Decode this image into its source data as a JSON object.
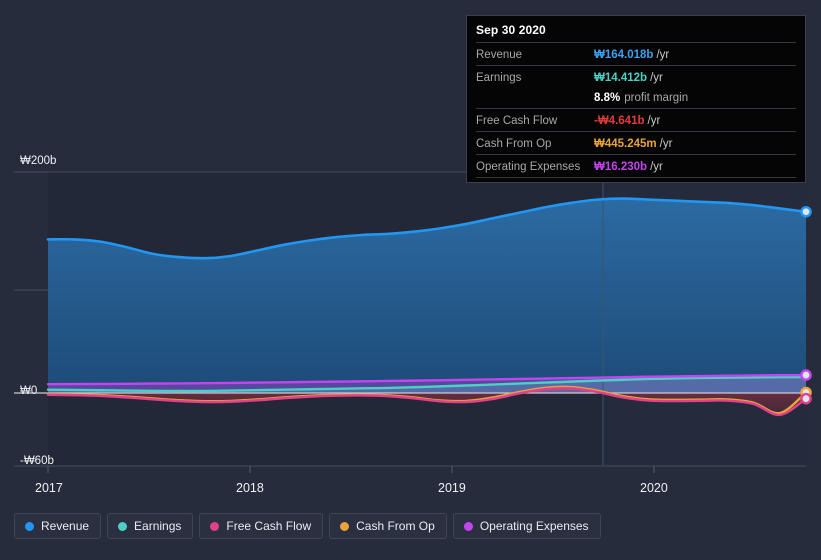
{
  "chart_data": {
    "type": "area",
    "title": "",
    "xlabel": "",
    "ylabel": "",
    "currency_symbol": "₩",
    "x_ticks": [
      "2017",
      "2018",
      "2019",
      "2020"
    ],
    "y_ticks": [
      "₩200b",
      "₩0",
      "-₩60b"
    ],
    "ylim": [
      -60,
      200
    ],
    "grid": true,
    "legend_position": "bottom",
    "series": [
      {
        "name": "Revenue",
        "color": "#2196F3",
        "values": [
          139,
          139,
          137,
          132,
          126,
          123,
          122,
          124,
          129,
          134,
          138,
          141,
          143,
          144,
          146,
          149,
          153,
          158,
          163,
          168,
          172,
          175,
          176,
          175,
          174,
          173,
          172,
          170,
          167,
          164
        ]
      },
      {
        "name": "Earnings",
        "color": "#4DD0C4",
        "values": [
          3.0,
          2.8,
          2.5,
          2.2,
          2.0,
          1.8,
          1.9,
          2.2,
          2.6,
          3.0,
          3.4,
          3.8,
          4.2,
          4.6,
          5.2,
          6.0,
          6.8,
          7.6,
          8.5,
          9.4,
          10.3,
          11.2,
          12.0,
          12.7,
          13.2,
          13.6,
          13.9,
          14.1,
          14.3,
          14.412
        ]
      },
      {
        "name": "Free Cash Flow",
        "color": "#E0418A",
        "values": [
          -1.5,
          -1.8,
          -2.4,
          -3.6,
          -5.2,
          -6.6,
          -7.4,
          -7.2,
          -6.0,
          -4.4,
          -3.0,
          -2.2,
          -2.0,
          -2.6,
          -4.4,
          -6.8,
          -7.4,
          -5.0,
          -0.5,
          3.4,
          4.2,
          1.0,
          -3.6,
          -6.2,
          -6.6,
          -6.4,
          -6.3,
          -9.0,
          -18.0,
          -4.641
        ]
      },
      {
        "name": "Cash From Op",
        "color": "#E8A33D",
        "values": [
          -0.8,
          -1.1,
          -1.7,
          -2.9,
          -4.5,
          -5.9,
          -6.7,
          -6.5,
          -5.3,
          -3.7,
          -2.3,
          -1.5,
          -1.3,
          -1.9,
          -3.7,
          -6.1,
          -6.5,
          -3.8,
          0.8,
          4.6,
          5.4,
          2.2,
          -2.6,
          -5.2,
          -5.6,
          -5.4,
          -5.3,
          -8.0,
          -16.5,
          0.445
        ]
      },
      {
        "name": "Operating Expenses",
        "color": "#C445F0",
        "values": [
          8.0,
          8.1,
          8.2,
          8.3,
          8.5,
          8.7,
          8.9,
          9.1,
          9.4,
          9.7,
          10.0,
          10.3,
          10.6,
          10.9,
          11.2,
          11.5,
          11.9,
          12.3,
          12.7,
          13.1,
          13.5,
          13.9,
          14.3,
          14.7,
          15.0,
          15.3,
          15.6,
          15.9,
          16.1,
          16.23
        ]
      }
    ]
  },
  "y_axis": {
    "top_label": "₩200b",
    "zero_label": "₩0",
    "bottom_label": "-₩60b"
  },
  "x_axis": {
    "ticks": [
      "2017",
      "2018",
      "2019",
      "2020"
    ]
  },
  "tooltip": {
    "title": "Sep 30 2020",
    "rows": [
      {
        "label": "Revenue",
        "value": "₩164.018b",
        "unit": "/yr",
        "color": "#3BA3F0",
        "sub": ""
      },
      {
        "label": "Earnings",
        "value": "₩14.412b",
        "unit": "/yr",
        "color": "#4DD0C4",
        "sub": ""
      },
      {
        "label": "",
        "value": "8.8%",
        "unit": "",
        "color": "#ffffff",
        "sub": "profit margin"
      },
      {
        "label": "Free Cash Flow",
        "value": "-₩4.641b",
        "unit": "/yr",
        "color": "#E03C3C",
        "sub": ""
      },
      {
        "label": "Cash From Op",
        "value": "₩445.245m",
        "unit": "/yr",
        "color": "#E8A33D",
        "sub": ""
      },
      {
        "label": "Operating Expenses",
        "value": "₩16.230b",
        "unit": "/yr",
        "color": "#C445F0",
        "sub": ""
      }
    ]
  },
  "legend": {
    "items": [
      {
        "label": "Revenue",
        "color": "#2196F3"
      },
      {
        "label": "Earnings",
        "color": "#4DD0C4"
      },
      {
        "label": "Free Cash Flow",
        "color": "#E0418A"
      },
      {
        "label": "Cash From Op",
        "color": "#E8A33D"
      },
      {
        "label": "Operating Expenses",
        "color": "#C445F0"
      }
    ]
  }
}
